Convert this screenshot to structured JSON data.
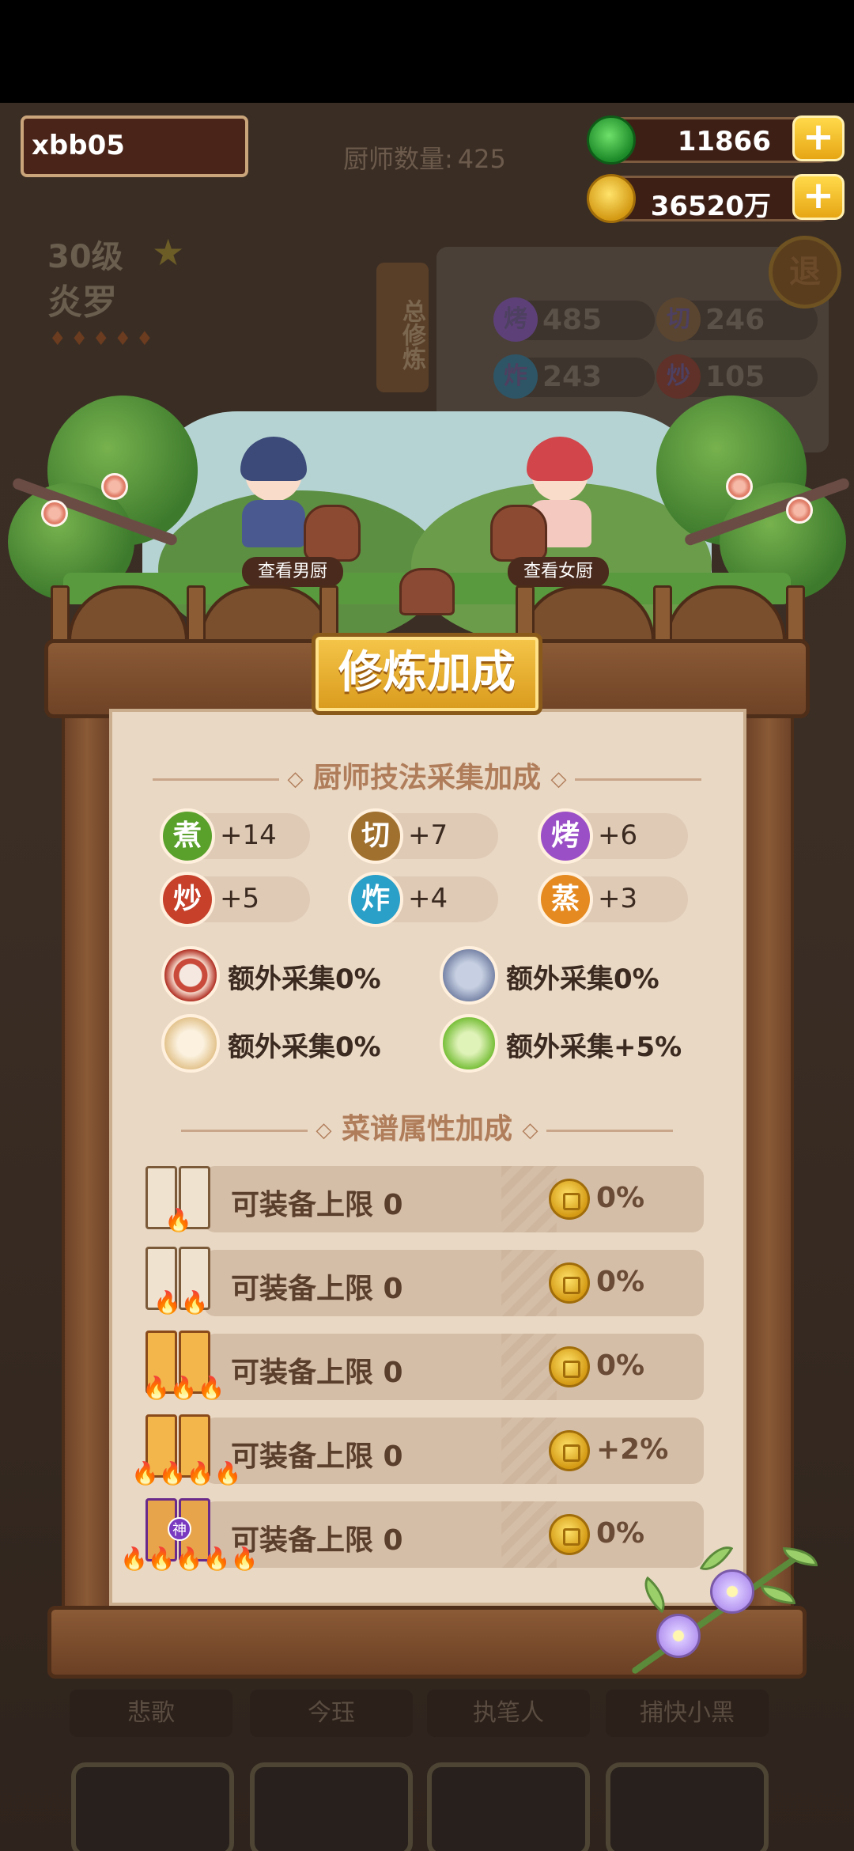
{
  "header": {
    "username": "xbb05",
    "chef_count_label": "厨师数量:",
    "chef_count_value": "425",
    "jade_value": "11866",
    "coin_value": "36520万",
    "plus": "+"
  },
  "hero": {
    "level": "30级",
    "name": "炎罗",
    "cultivation_side_label": "总修炼",
    "exit_label": "退",
    "mini_skills": [
      {
        "icon": "烤",
        "value": "485"
      },
      {
        "icon": "切",
        "value": "246"
      },
      {
        "icon": "炸",
        "value": "243"
      },
      {
        "icon": "炒",
        "value": "105"
      }
    ]
  },
  "scene": {
    "view_male": "查看男厨",
    "view_female": "查看女厨"
  },
  "modal": {
    "title": "修炼加成",
    "section1_title": "厨师技法采集加成",
    "skills": [
      {
        "icon": "煮",
        "value": "+14",
        "color": "#5aa12c"
      },
      {
        "icon": "切",
        "value": "+7",
        "color": "#a0702e"
      },
      {
        "icon": "烤",
        "value": "+6",
        "color": "#9b4fc7"
      },
      {
        "icon": "炒",
        "value": "+5",
        "color": "#c6402a"
      },
      {
        "icon": "炸",
        "value": "+4",
        "color": "#2a9fc8"
      },
      {
        "icon": "蒸",
        "value": "+3",
        "color": "#e58a20"
      }
    ],
    "extras": [
      {
        "label": "额外采集0%",
        "icon": "meat-icon"
      },
      {
        "label": "额外采集0%",
        "icon": "fish-icon"
      },
      {
        "label": "额外采集0%",
        "icon": "bun-icon"
      },
      {
        "label": "额外采集+5%",
        "icon": "cabbage-icon"
      }
    ],
    "section2_title": "菜谱属性加成",
    "recipes": [
      {
        "label": "可装备上限 0",
        "bonus": "0%"
      },
      {
        "label": "可装备上限 0",
        "bonus": "0%"
      },
      {
        "label": "可装备上限 0",
        "bonus": "0%"
      },
      {
        "label": "可装备上限 0",
        "bonus": "+2%"
      },
      {
        "label": "可装备上限 0",
        "bonus": "0%"
      }
    ],
    "shen": "神"
  },
  "bottom": {
    "names": [
      "悲歌",
      "今珏",
      "执笔人",
      "捕快小黑"
    ]
  }
}
